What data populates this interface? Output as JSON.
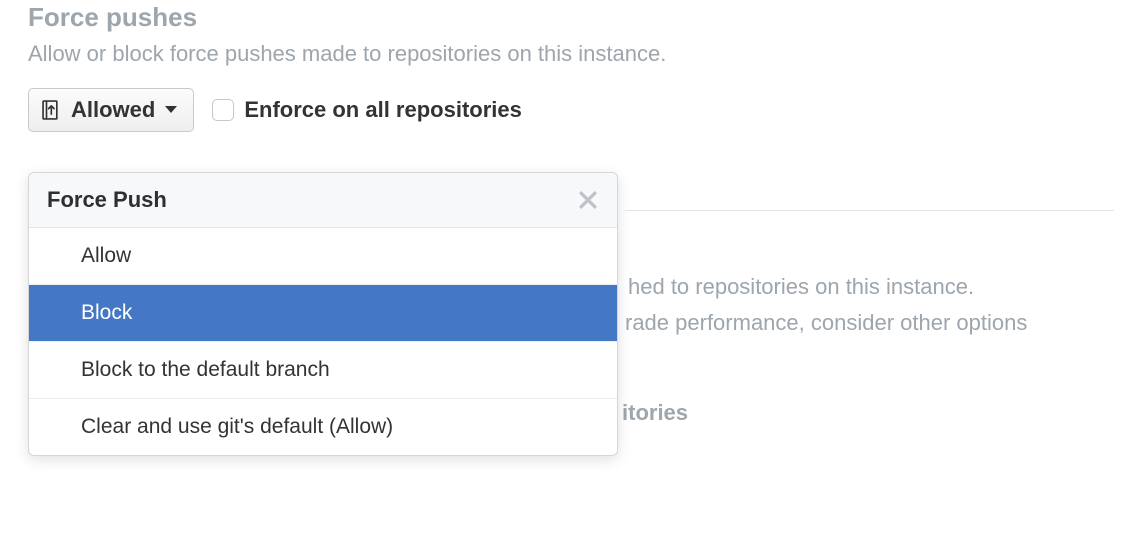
{
  "force_pushes": {
    "title": "Force pushes",
    "description": "Allow or block force pushes made to repositories on this instance.",
    "dropdown_button_label": "Allowed",
    "enforce_label": "Enforce on all repositories"
  },
  "dropdown": {
    "title": "Force Push",
    "options": {
      "allow": "Allow",
      "block": "Block",
      "block_default": "Block to the default branch",
      "clear": "Clear and use git's default (Allow)"
    }
  },
  "background": {
    "line1": "hed to repositories on this instance.",
    "line2": "rade performance, consider other options",
    "line3": "itories"
  }
}
